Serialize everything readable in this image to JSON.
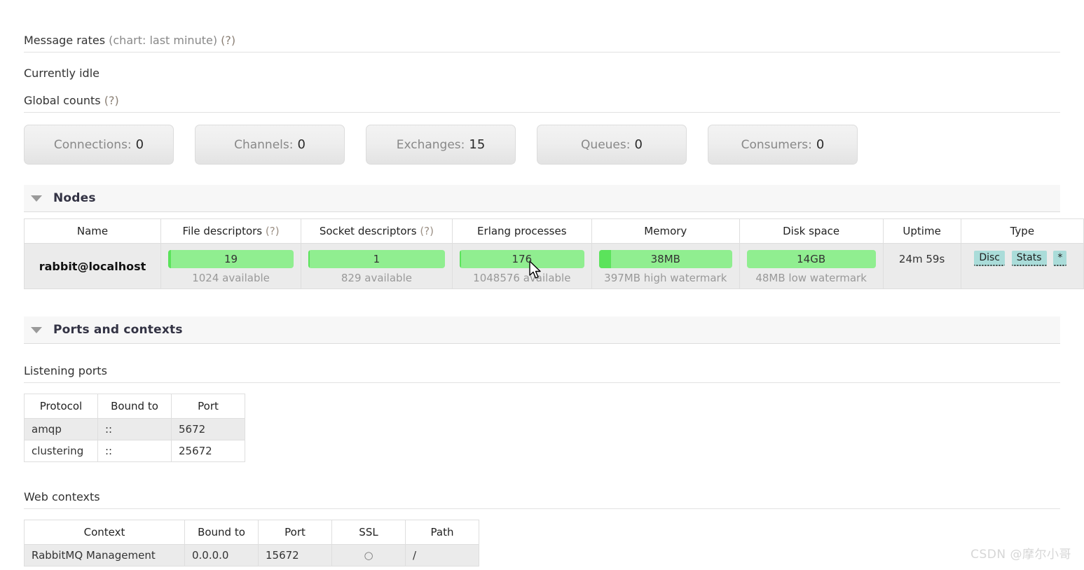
{
  "overview": {
    "message_rates": {
      "title": "Message rates",
      "subtitle": "(chart: last minute)",
      "help": "(?)"
    },
    "idle_text": "Currently idle",
    "global_counts": {
      "title": "Global counts",
      "help": "(?)",
      "items": [
        {
          "label": "Connections:",
          "value": "0"
        },
        {
          "label": "Channels:",
          "value": "0"
        },
        {
          "label": "Exchanges:",
          "value": "15"
        },
        {
          "label": "Queues:",
          "value": "0"
        },
        {
          "label": "Consumers:",
          "value": "0"
        }
      ]
    }
  },
  "nodes_section": {
    "title": "Nodes",
    "columns": [
      {
        "label": "Name",
        "help": ""
      },
      {
        "label": "File descriptors",
        "help": "(?)"
      },
      {
        "label": "Socket descriptors",
        "help": "(?)"
      },
      {
        "label": "Erlang processes",
        "help": ""
      },
      {
        "label": "Memory",
        "help": ""
      },
      {
        "label": "Disk space",
        "help": ""
      },
      {
        "label": "Uptime",
        "help": ""
      },
      {
        "label": "Type",
        "help": ""
      }
    ],
    "row": {
      "name": "rabbit@localhost",
      "file_descriptors": {
        "value": "19",
        "sub": "1024 available",
        "fill_pct": "2"
      },
      "socket_descriptors": {
        "value": "1",
        "sub": "829 available",
        "fill_pct": "1"
      },
      "erlang_processes": {
        "value": "176",
        "sub": "1048576 available",
        "fill_pct": "1"
      },
      "memory": {
        "value": "38MB",
        "sub": "397MB high watermark",
        "fill_pct": "9"
      },
      "disk_space": {
        "value": "14GB",
        "sub": "48MB low watermark",
        "fill_pct": "0"
      },
      "uptime": "24m 59s",
      "type_badges": [
        "Disc",
        "Stats",
        "*"
      ]
    }
  },
  "ports_section": {
    "title": "Ports and contexts",
    "listening_ports": {
      "heading": "Listening ports",
      "columns": [
        "Protocol",
        "Bound to",
        "Port"
      ],
      "rows": [
        {
          "protocol": "amqp",
          "bound_to": "::",
          "port": "5672"
        },
        {
          "protocol": "clustering",
          "bound_to": "::",
          "port": "25672"
        }
      ]
    },
    "web_contexts": {
      "heading": "Web contexts",
      "columns": [
        "Context",
        "Bound to",
        "Port",
        "SSL",
        "Path"
      ],
      "rows": [
        {
          "context": "RabbitMQ Management",
          "bound_to": "0.0.0.0",
          "port": "15672",
          "ssl": "○",
          "path": "/"
        }
      ]
    }
  },
  "watermark": "CSDN @摩尔小哥",
  "colors": {
    "gauge_track": "#90ee90",
    "gauge_fill": "#5be35b",
    "badge": "#aadcd9",
    "section_bar": "#f7f7f7",
    "row": "#ebebeb"
  }
}
